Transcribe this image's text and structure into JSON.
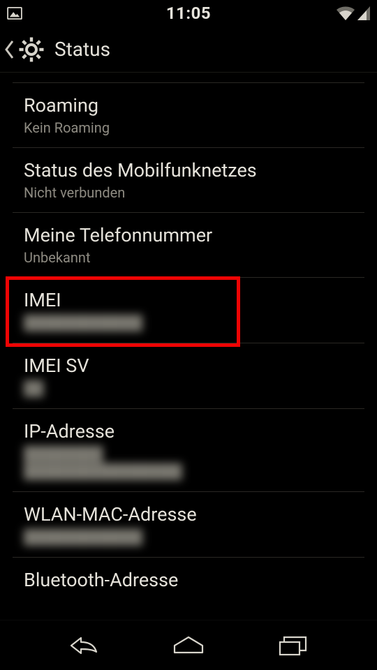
{
  "status_bar": {
    "time": "11:05"
  },
  "action_bar": {
    "title": "Status"
  },
  "items": [
    {
      "title": "Roaming",
      "sub": "Kein Roaming",
      "blur": false,
      "highlight": false
    },
    {
      "title": "Status des Mobilfunknetzes",
      "sub": "Nicht verbunden",
      "blur": false,
      "highlight": false
    },
    {
      "title": "Meine Telefonnummer",
      "sub": "Unbekannt",
      "blur": false,
      "highlight": false
    },
    {
      "title": "IMEI",
      "sub": "████████████",
      "blur": true,
      "highlight": true
    },
    {
      "title": "IMEI SV",
      "sub": "██",
      "blur": true,
      "highlight": false
    },
    {
      "title": "IP-Adresse",
      "sub": "████████\n████████████████",
      "blur": true,
      "highlight": false
    },
    {
      "title": "WLAN-MAC-Adresse",
      "sub": "████████████",
      "blur": true,
      "highlight": false
    },
    {
      "title": "Bluetooth-Adresse",
      "sub": "",
      "blur": false,
      "highlight": false
    }
  ]
}
